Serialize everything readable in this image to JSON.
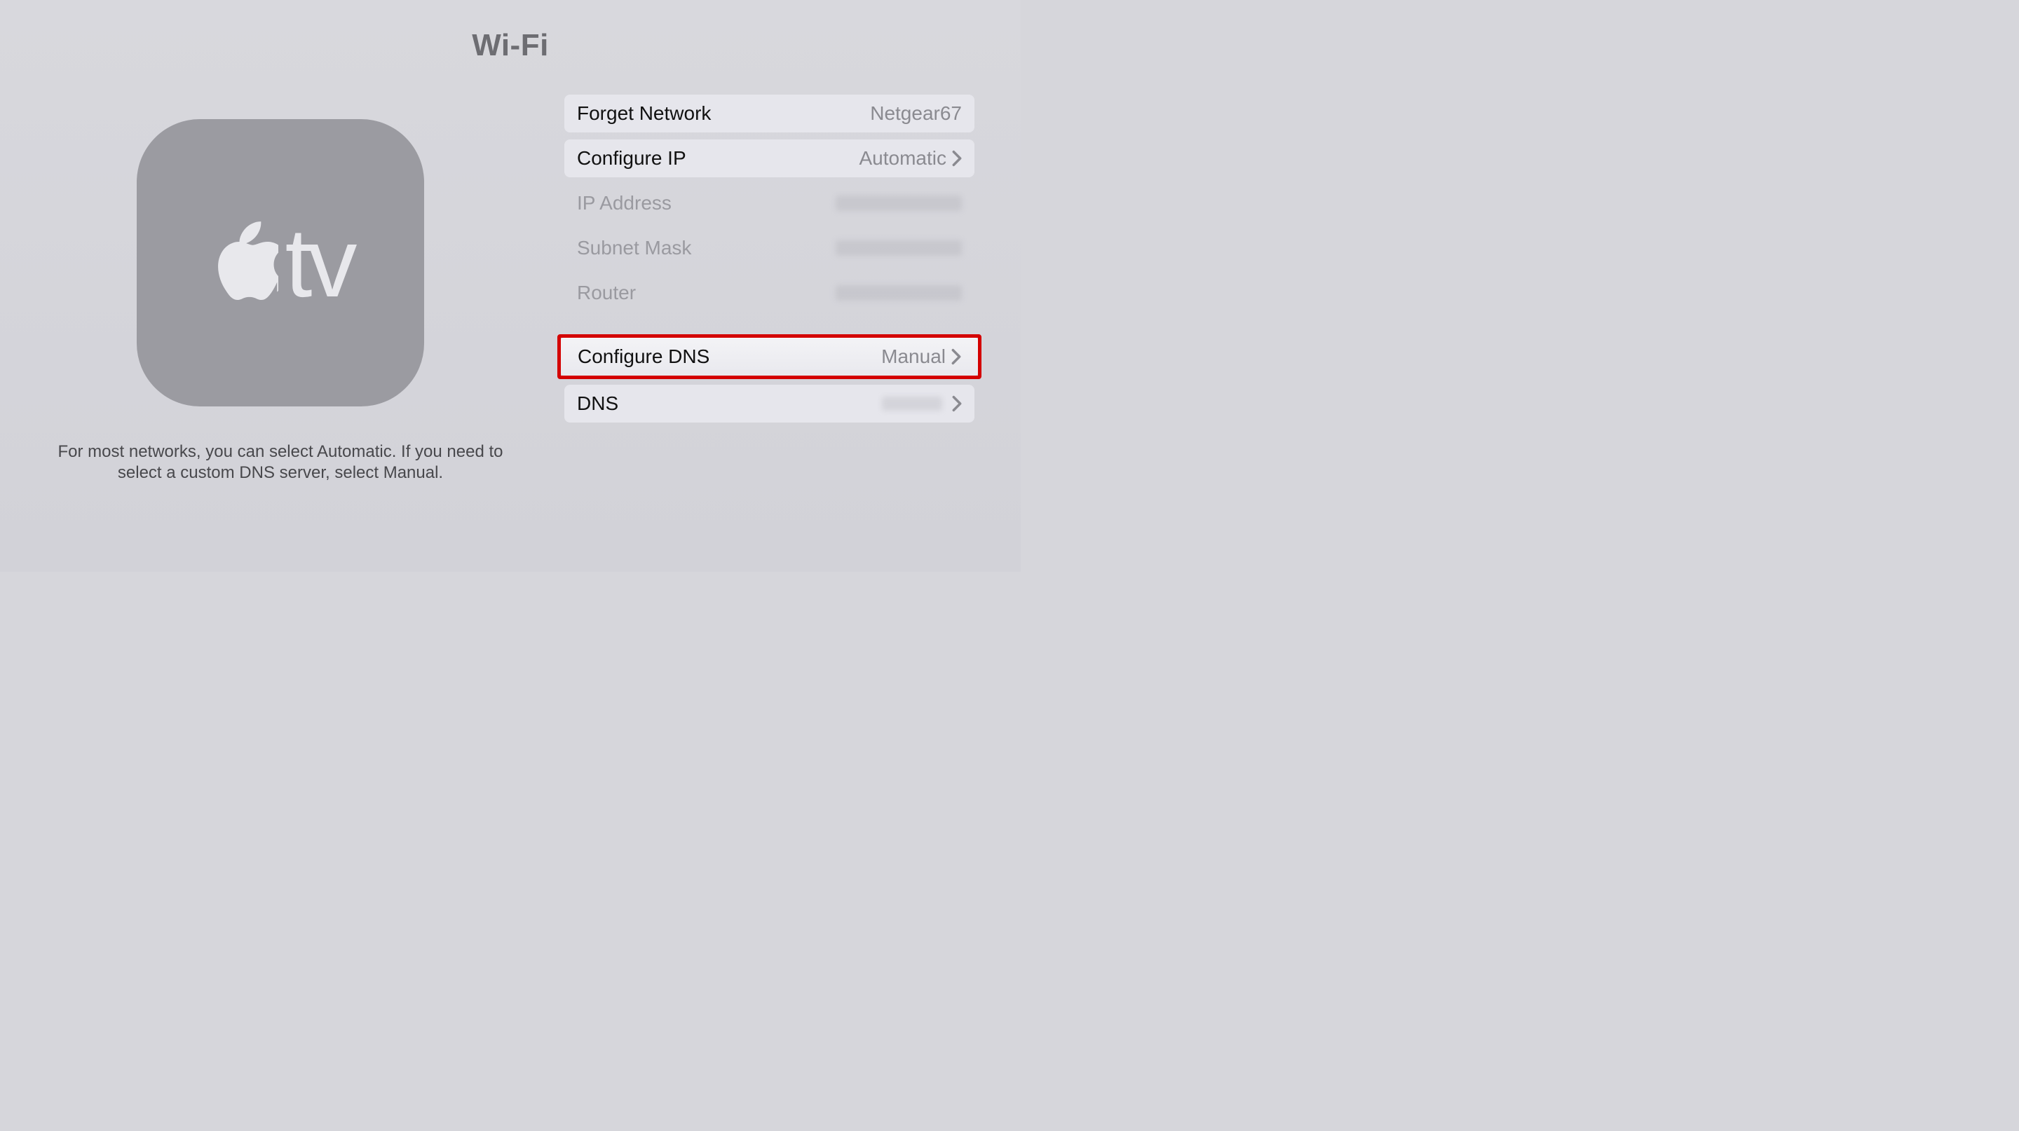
{
  "title": "Wi-Fi",
  "left": {
    "tile_logo_text": "tv",
    "description": "For most networks, you can select Automatic. If you need to select a custom DNS server, select Manual."
  },
  "rows": {
    "forget": {
      "label": "Forget Network",
      "value": "Netgear67"
    },
    "configure_ip": {
      "label": "Configure IP",
      "value": "Automatic"
    },
    "ip_address": {
      "label": "IP Address"
    },
    "subnet_mask": {
      "label": "Subnet Mask"
    },
    "router": {
      "label": "Router"
    },
    "configure_dns": {
      "label": "Configure DNS",
      "value": "Manual"
    },
    "dns": {
      "label": "DNS"
    }
  }
}
